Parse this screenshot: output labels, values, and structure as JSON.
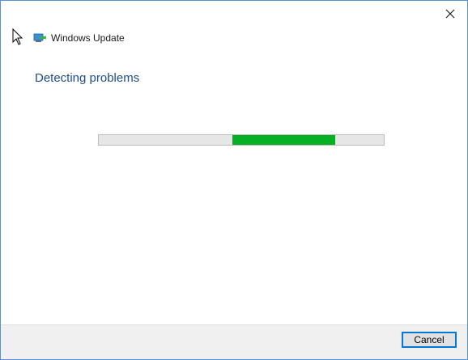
{
  "window": {
    "close_icon": "close-icon",
    "back_icon": "back-arrow-icon"
  },
  "header": {
    "app_title": "Windows Update",
    "app_icon": "windows-update-icon"
  },
  "main": {
    "heading": "Detecting problems",
    "progress": {
      "mode": "indeterminate",
      "chunk_start_fraction": 0.47,
      "chunk_end_fraction": 0.83,
      "color": "#06b025"
    }
  },
  "footer": {
    "cancel_label": "Cancel"
  },
  "colors": {
    "heading": "#1f4e8c",
    "progress": "#06b025",
    "focus_border": "#0078d7"
  }
}
